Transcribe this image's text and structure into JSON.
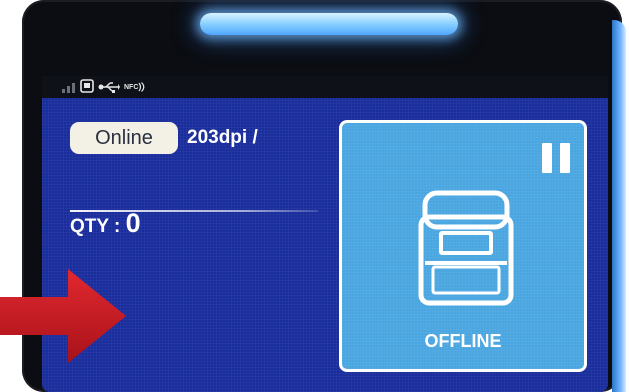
{
  "status_bar": {
    "icons": [
      "signal-icon",
      "sd-card-icon",
      "usb-icon",
      "nfc-icon"
    ],
    "nfc_label": "NFC"
  },
  "status": {
    "online_label": "Online",
    "resolution": "203dpi /"
  },
  "qty": {
    "label": "QTY : ",
    "value": "0"
  },
  "printer_panel": {
    "state_label": "OFFLINE",
    "pause_icon": "pause-icon",
    "printer_icon": "printer-icon"
  },
  "colors": {
    "screen_bg": "#1a2d9c",
    "panel_bg": "#4aa6e0",
    "led": "#8fd3ff",
    "arrow": "#d3222a"
  }
}
